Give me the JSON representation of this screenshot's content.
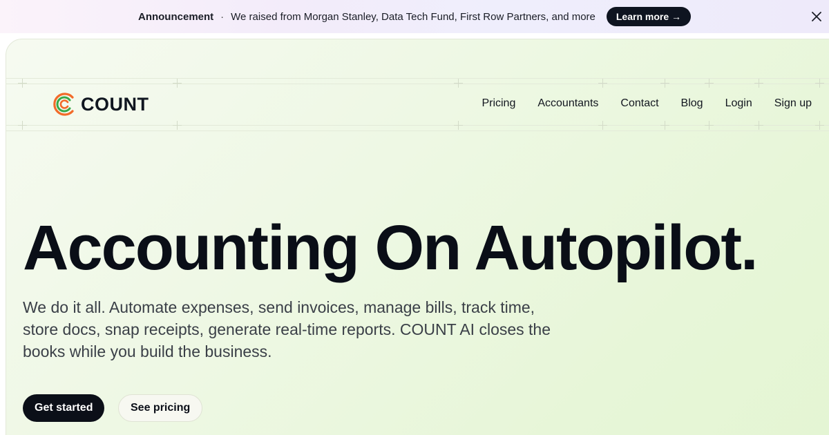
{
  "announcement": {
    "label": "Announcement",
    "separator": "·",
    "message": "We raised from Morgan Stanley, Data Tech Fund, First Row Partners, and more",
    "cta": "Learn more →"
  },
  "brand": {
    "name": "COUNT",
    "colors": {
      "orange": "#f26b2a",
      "green": "#39a849",
      "dark": "#0b0f18"
    }
  },
  "nav": {
    "items": [
      "Pricing",
      "Accountants",
      "Contact",
      "Blog",
      "Login",
      "Sign up"
    ]
  },
  "hero": {
    "title": "Accounting On Autopilot.",
    "subtitle": "We do it all. Automate expenses, send invoices, manage bills, track time, store docs, snap receipts, generate real-time reports. COUNT AI closes the books while you build the business.",
    "primary_cta": "Get started",
    "secondary_cta": "See pricing"
  },
  "icons": {
    "close": "close-icon",
    "logo": "count-logo-icon"
  }
}
